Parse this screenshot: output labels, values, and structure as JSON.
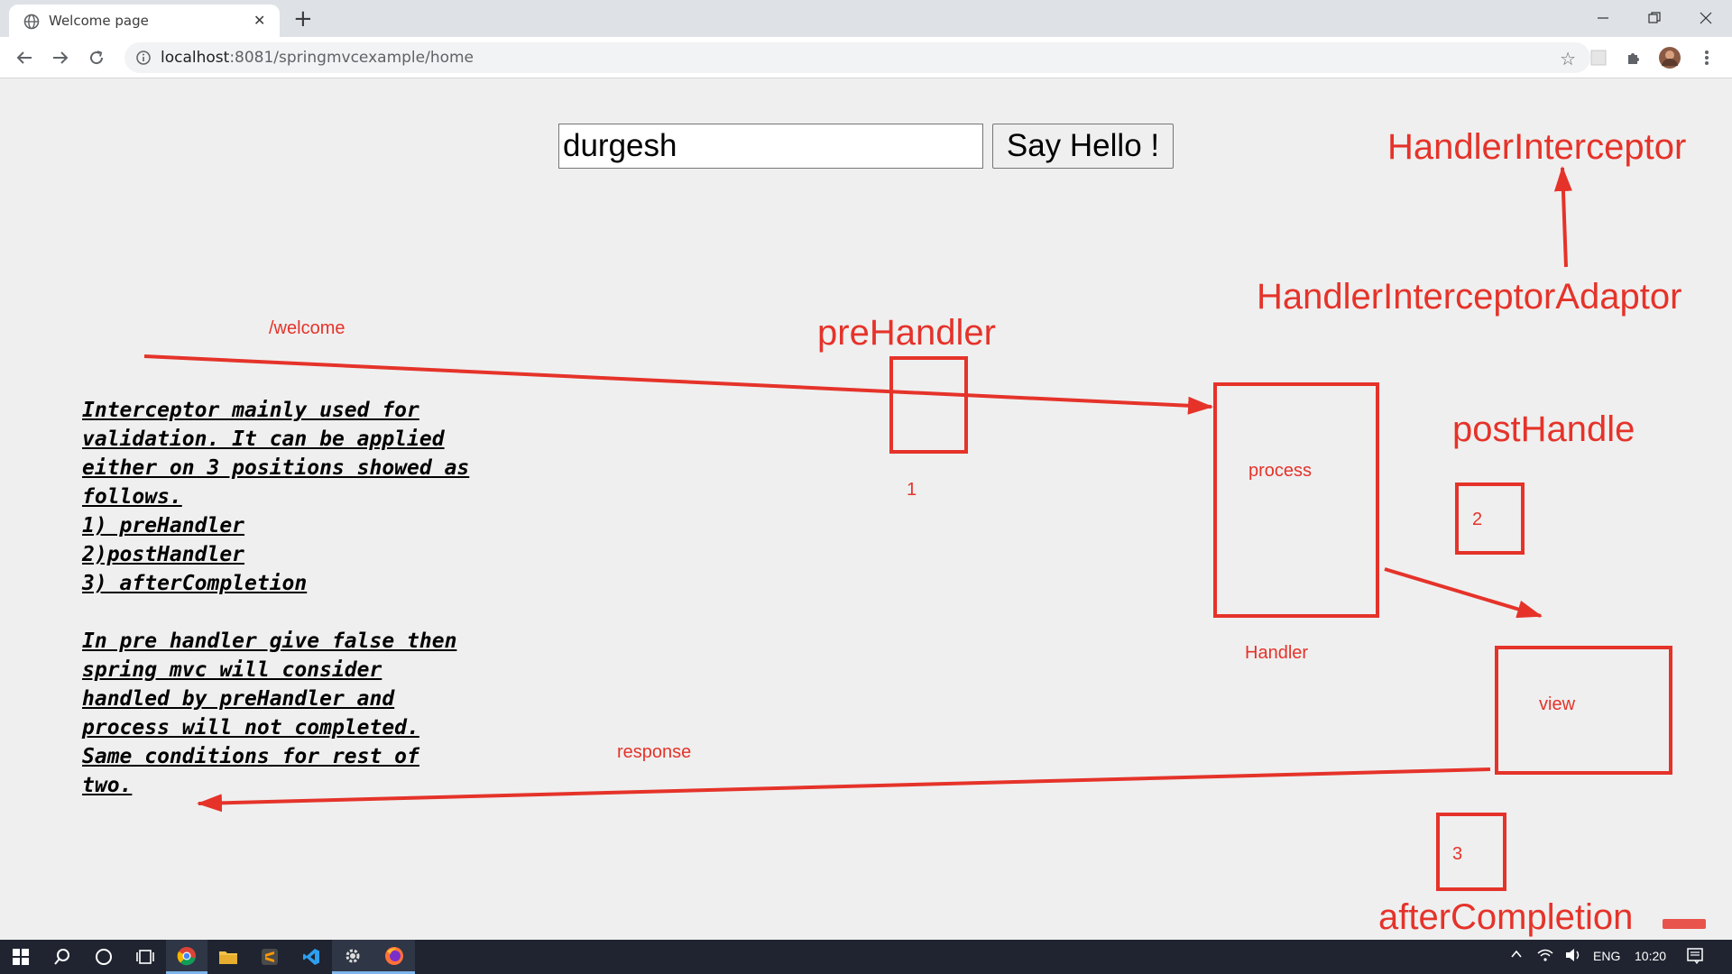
{
  "browser": {
    "tab_title": "Welcome page",
    "tab_close": "✕",
    "new_tab": "+",
    "url_host": "localhost",
    "url_rest": ":8081/springmvcexample/home",
    "bookmark_icon": "☆"
  },
  "page": {
    "input_value": "durgesh",
    "button_label": "Say Hello !",
    "notes_block1": [
      "Interceptor mainly used for",
      "validation. It can be applied",
      "either on 3 positions showed as",
      "follows.",
      "1) preHandler",
      "2)postHandler",
      "3) afterCompletion"
    ],
    "notes_block2": [
      "In pre handler give false then",
      "spring mvc will consider",
      "handled by preHandler and",
      "process will not completed.",
      "Same conditions for rest of",
      "two."
    ]
  },
  "diagram": {
    "handler_interceptor": "HandlerInterceptor",
    "handler_interceptor_adaptor": "HandlerInterceptorAdaptor",
    "welcome_path": "/welcome",
    "pre_handler": "preHandler",
    "label_1": "1",
    "process": "process",
    "handler": "Handler",
    "post_handle": "postHandle",
    "label_2": "2",
    "view": "view",
    "response": "response",
    "label_3": "3",
    "after_completion": "afterCompletion",
    "accent_color": "#e5332a"
  },
  "taskbar": {
    "lang": "ENG",
    "time": "10:20"
  }
}
